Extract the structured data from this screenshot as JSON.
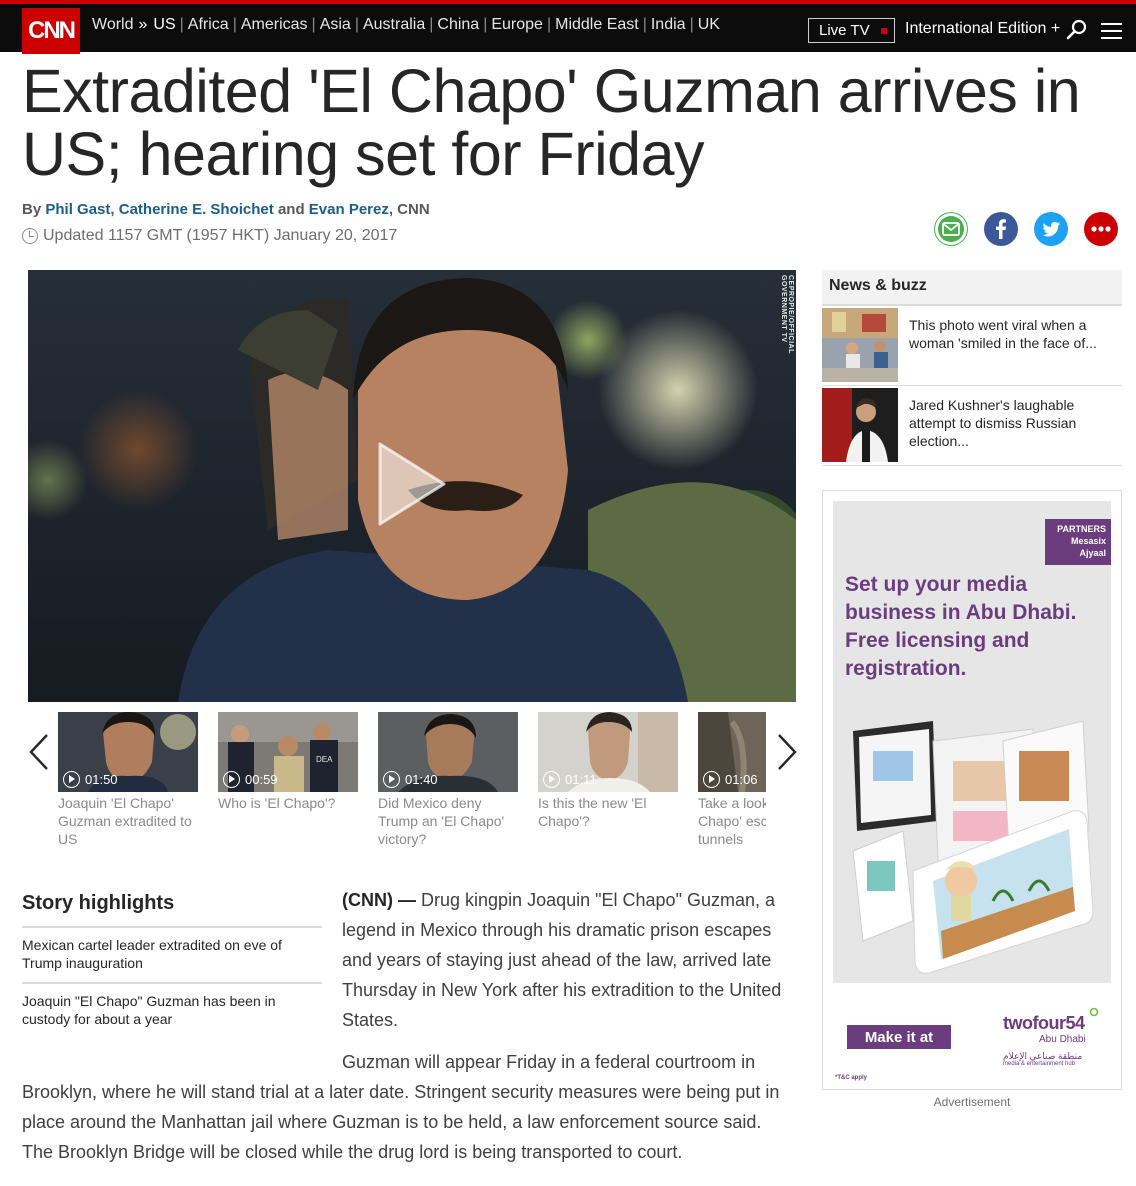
{
  "nav": {
    "logo": "CNN",
    "links": [
      {
        "label": "World",
        "active": false
      },
      {
        "label": "US",
        "active": true
      },
      {
        "label": "Africa",
        "active": false
      },
      {
        "label": "Americas",
        "active": false
      },
      {
        "label": "Asia",
        "active": false
      },
      {
        "label": "Australia",
        "active": false
      },
      {
        "label": "China",
        "active": false
      },
      {
        "label": "Europe",
        "active": false
      },
      {
        "label": "Middle East",
        "active": false
      },
      {
        "label": "India",
        "active": false
      },
      {
        "label": "UK",
        "active": false
      }
    ],
    "live_tv": "Live TV",
    "edition": "International Edition +",
    "search_icon": "search-icon",
    "menu_icon": "hamburger-menu-icon"
  },
  "article": {
    "headline": "Extradited 'El Chapo' Guzman arrives in US; hearing set for Friday",
    "byline": {
      "prefix": "By",
      "authors": [
        "Phil Gast",
        "Catherine E. Shoichet",
        "Evan Perez"
      ],
      "sep1": ",",
      "and": "and",
      "suffix": ", CNN"
    },
    "updated": "Updated 1157 GMT (1957 HKT) January 20, 2017",
    "share_icons": [
      "email-icon",
      "facebook-icon",
      "twitter-icon",
      "more-icon"
    ]
  },
  "video": {
    "credit": "CEPROPIE/OFFICIAL GOVERNMENT TV",
    "play_icon": "play-icon"
  },
  "carousel": {
    "items": [
      {
        "duration": "01:50",
        "caption": "Joaquin 'El Chapo' Guzman extradited to US"
      },
      {
        "duration": "00:59",
        "caption": "Who is 'El Chapo'?"
      },
      {
        "duration": "01:40",
        "caption": "Did Mexico deny Trump an 'El Chapo' victory?"
      },
      {
        "duration": "01:11",
        "caption": "Is this the new 'El Chapo'?"
      },
      {
        "duration": "01:06",
        "caption": "Take a look at 'El Chapo' escape tunnels"
      }
    ]
  },
  "highlights": {
    "title": "Story highlights",
    "items": [
      "Mexican cartel leader extradited on eve of Trump inauguration",
      "Joaquin \"El Chapo\" Guzman has been in custody for about a year"
    ]
  },
  "body": {
    "dateline": "(CNN) —",
    "p1": "Drug kingpin Joaquin \"El Chapo\" Guzman, a legend in Mexico through his dramatic prison escapes and years of staying just ahead of the law, arrived late Thursday in New York after his extradition to the United States.",
    "p2": "Guzman will appear Friday in a federal courtroom in Brooklyn, where he will stand trial at a later date. Stringent security measures were being put in place around the Manhattan jail where Guzman is to be held, a law enforcement source said. The Brooklyn Bridge will be closed while the drug lord is being transported to court."
  },
  "sidebar": {
    "title": "News & buzz",
    "items": [
      {
        "text": "This photo went viral when a woman 'smiled in the face of..."
      },
      {
        "text": "Jared Kushner's laughable attempt to dismiss Russian election..."
      }
    ]
  },
  "ad": {
    "partners": [
      "PARTNERS",
      "Mesasix",
      "Ajyaal"
    ],
    "headline": "Set up your media business in Abu Dhabi. Free licensing and registration.",
    "cta": "Make it at",
    "brand": "twofour54",
    "brand_sub": "Abu Dhabi",
    "brand_arabic": "منطقة صناعي الإعلام",
    "brand_tagline": "media & entertainment hub",
    "tc": "*T&C apply",
    "label": "Advertisement",
    "brand_color": "#6b3c7e"
  },
  "colors": {
    "cnn_red": "#cc0000",
    "link_blue": "#1a5e8a",
    "nav_bg": "#0c0c0c"
  }
}
